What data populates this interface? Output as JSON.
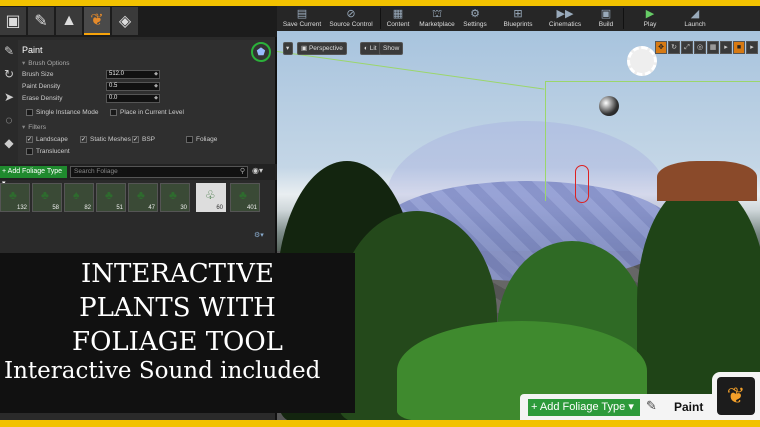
{
  "panel": {
    "title": "Paint",
    "brush_options_header": "Brush Options",
    "brush_size_label": "Brush Size",
    "brush_size_value": "512.0",
    "paint_density_label": "Paint Density",
    "paint_density_value": "0.5",
    "erase_density_label": "Erase Density",
    "erase_density_value": "0.0",
    "single_instance_label": "Single Instance Mode",
    "place_in_level_label": "Place in Current Level",
    "filters_header": "Filters",
    "filter_landscape": "Landscape",
    "filter_static_meshes": "Static Meshes",
    "filter_bsp": "BSP",
    "filter_foliage": "Foliage",
    "filter_translucent": "Translucent"
  },
  "foliage_bar": {
    "add_label": "+ Add Foliage Type ▾",
    "search_placeholder": "Search Foliage"
  },
  "thumbnails": [
    "132",
    "58",
    "82",
    "51",
    "47",
    "30",
    "60",
    "401"
  ],
  "toolbar": {
    "save_current": "Save Current",
    "source_control": "Source Control",
    "content": "Content",
    "marketplace": "Marketplace",
    "settings": "Settings",
    "blueprints": "Blueprints",
    "cinematics": "Cinematics",
    "build": "Build",
    "play": "Play",
    "launch": "Launch"
  },
  "viewport": {
    "perspective": "Perspective",
    "lit": "Lit",
    "show": "Show"
  },
  "promo": {
    "line1": "INTERACTIVE",
    "line2": "PLANTS WITH",
    "line3": "FOLIAGE TOOL",
    "line4": "Interactive Sound included"
  },
  "badge": {
    "add_label": "+ Add Foliage Type ▾",
    "paint_label": "Paint"
  },
  "colors": {
    "frame_yellow": "#f2c200",
    "add_green": "#2d9a3a",
    "active_orange": "#f7a30a"
  }
}
